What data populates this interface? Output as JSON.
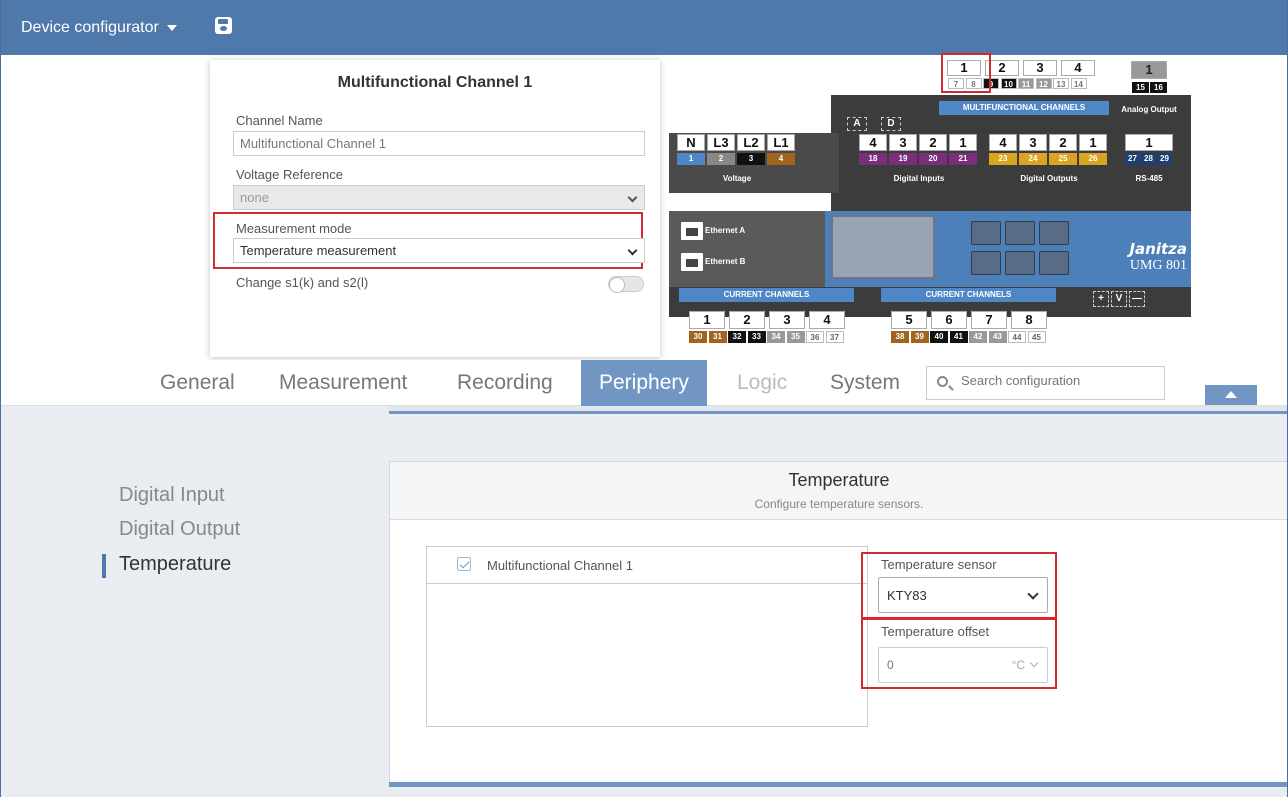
{
  "topbar": {
    "title": "Device configurator"
  },
  "channel_panel": {
    "title": "Multifunctional Channel 1",
    "channel_name_label": "Channel Name",
    "channel_name_value": "Multifunctional Channel 1",
    "voltage_reference_label": "Voltage Reference",
    "voltage_reference_value": "none",
    "measurement_mode_label": "Measurement mode",
    "measurement_mode_value": "Temperature measurement",
    "change_label": "Change s1(k) and s2(l)"
  },
  "device": {
    "mf_numbers": [
      "1",
      "2",
      "3",
      "4"
    ],
    "mf_terminals": [
      "7",
      "8",
      "9",
      "10",
      "11",
      "12",
      "13",
      "14"
    ],
    "mf_label": "MULTIFUNCTIONAL CHANNELS",
    "analog_number": "1",
    "analog_terminals": [
      "15",
      "16"
    ],
    "analog_label": "Analog Output",
    "ad_labels": [
      "A",
      "D"
    ],
    "voltage_numbers": [
      "N",
      "L3",
      "L2",
      "L1"
    ],
    "voltage_chips": [
      "1",
      "2",
      "3",
      "4"
    ],
    "voltage_label": "Voltage",
    "din_numbers": [
      "4",
      "3",
      "2",
      "1"
    ],
    "din_chips": [
      "18",
      "19",
      "20",
      "21"
    ],
    "din_label": "Digital Inputs",
    "dout_numbers": [
      "4",
      "3",
      "2",
      "1"
    ],
    "dout_chips": [
      "23",
      "24",
      "25",
      "26"
    ],
    "dout_label": "Digital Outputs",
    "rs_number": "1",
    "rs_chips": [
      "27",
      "28",
      "29"
    ],
    "rs_label": "RS-485",
    "eth_a": "Ethernet A",
    "eth_b": "Ethernet B",
    "brand": "Janitza",
    "model": "UMG 801",
    "cc_label": "CURRENT CHANNELS",
    "cc1_numbers": [
      "1",
      "2",
      "3",
      "4"
    ],
    "cc1_chips": [
      "30",
      "31",
      "32",
      "33",
      "34",
      "35",
      "36",
      "37"
    ],
    "cc2_numbers": [
      "5",
      "6",
      "7",
      "8"
    ],
    "cc2_chips": [
      "38",
      "39",
      "40",
      "41",
      "42",
      "43",
      "44",
      "45"
    ],
    "pvm": [
      "+",
      "V",
      "—"
    ]
  },
  "tabs": [
    {
      "label": "General"
    },
    {
      "label": "Measurement"
    },
    {
      "label": "Recording"
    },
    {
      "label": "Periphery"
    },
    {
      "label": "Logic"
    },
    {
      "label": "System"
    }
  ],
  "search": {
    "placeholder": "Search configuration"
  },
  "sidebar": {
    "items": [
      {
        "label": "Digital Input"
      },
      {
        "label": "Digital Output"
      },
      {
        "label": "Temperature"
      }
    ]
  },
  "card": {
    "title": "Temperature",
    "subtitle": "Configure temperature sensors.",
    "channel_item": "Multifunctional Channel 1",
    "sensor_label": "Temperature sensor",
    "sensor_value": "KTY83",
    "offset_label": "Temperature offset",
    "offset_value": "0",
    "offset_unit": "°C"
  },
  "colors": {
    "accent": "#4f78ab",
    "tab_active": "#7196c4",
    "highlight": "#d3292f"
  }
}
